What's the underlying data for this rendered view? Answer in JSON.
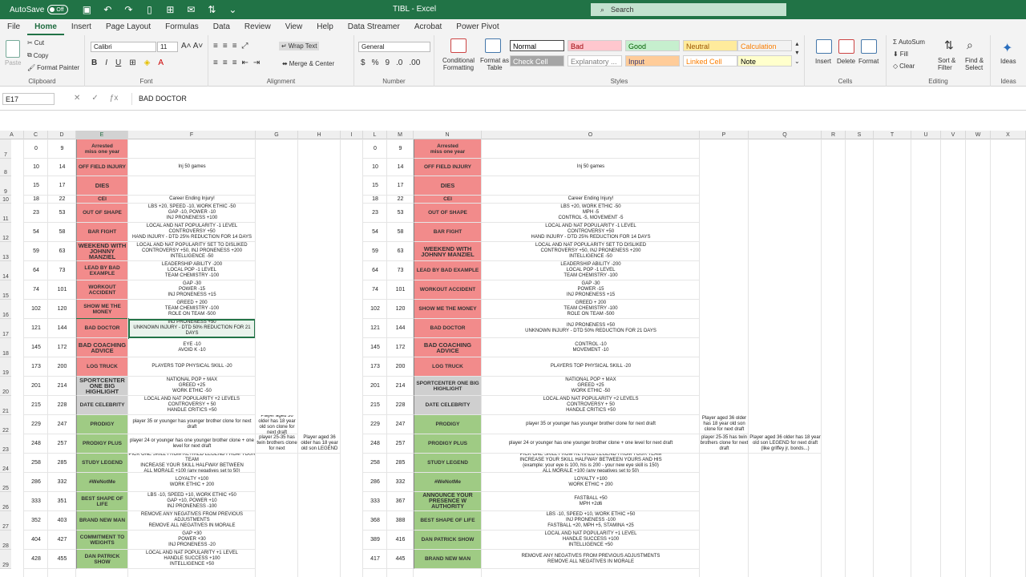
{
  "window": {
    "autosave": "AutoSave",
    "toggle": "Off",
    "title": "TIBL  -  Excel",
    "search_placeholder": "Search"
  },
  "menu": [
    "File",
    "Home",
    "Insert",
    "Page Layout",
    "Formulas",
    "Data",
    "Review",
    "View",
    "Help",
    "Data Streamer",
    "Acrobat",
    "Power Pivot"
  ],
  "ribbon": {
    "clipboard": {
      "paste": "Paste",
      "cut": "Cut",
      "copy": "Copy",
      "format_painter": "Format Painter",
      "label": "Clipboard"
    },
    "font": {
      "name": "Calibri",
      "size": "11",
      "label": "Font"
    },
    "alignment": {
      "wrap": "Wrap Text",
      "merge": "Merge & Center",
      "label": "Alignment"
    },
    "number": {
      "format": "General",
      "label": "Number"
    },
    "styles": {
      "conditional": "Conditional Formatting",
      "format_table": "Format as Table",
      "label": "Styles",
      "cells": [
        {
          "t": "Normal",
          "bg": "#ffffff",
          "fg": "#000000"
        },
        {
          "t": "Bad",
          "bg": "#ffc7ce",
          "fg": "#9c0006"
        },
        {
          "t": "Good",
          "bg": "#c6efce",
          "fg": "#006100"
        },
        {
          "t": "Neutral",
          "bg": "#ffeb9c",
          "fg": "#9c5700"
        },
        {
          "t": "Calculation",
          "bg": "#f2f2f2",
          "fg": "#fa7d00"
        },
        {
          "t": "Check Cell",
          "bg": "#a5a5a5",
          "fg": "#ffffff"
        },
        {
          "t": "Explanatory ...",
          "bg": "#ffffff",
          "fg": "#7f7f7f"
        },
        {
          "t": "Input",
          "bg": "#ffcc99",
          "fg": "#3f3f76"
        },
        {
          "t": "Linked Cell",
          "bg": "#ffffff",
          "fg": "#fa7d00"
        },
        {
          "t": "Note",
          "bg": "#ffffcc",
          "fg": "#000000"
        }
      ]
    },
    "cells": {
      "insert": "Insert",
      "delete": "Delete",
      "format": "Format",
      "label": "Cells"
    },
    "editing": {
      "autosum": "AutoSum",
      "fill": "Fill",
      "clear": "Clear",
      "sort": "Sort & Filter",
      "find": "Find & Select",
      "label": "Editing"
    },
    "ideas": {
      "label": "Ideas",
      "btn": "Ideas"
    }
  },
  "formula_bar": {
    "namebox": "E17",
    "content": "BAD DOCTOR"
  },
  "columns": [
    "A",
    "C",
    "D",
    "E",
    "F",
    "G",
    "H",
    "I",
    "L",
    "M",
    "N",
    "O",
    "P",
    "Q",
    "R",
    "S",
    "T",
    "U",
    "V",
    "W",
    "X"
  ],
  "rows": [
    {
      "n": "7",
      "c": "0",
      "d": "9",
      "e": "Arrested\nmiss one year",
      "f": "",
      "l": "0",
      "m": "9",
      "o": "",
      "color": "red"
    },
    {
      "n": "8",
      "c": "10",
      "d": "14",
      "e": "OFF FIELD INJURY",
      "f": "Inj 50 games",
      "l": "10",
      "m": "14",
      "o": "Inj 50 games",
      "color": "red"
    },
    {
      "n": "9",
      "c": "15",
      "d": "17",
      "e": "DIES",
      "f": "",
      "l": "15",
      "m": "17",
      "o": "",
      "color": "red"
    },
    {
      "n": "10",
      "c": "18",
      "d": "22",
      "e": "CEI",
      "f": "Career Ending Injury!",
      "l": "18",
      "m": "22",
      "o": "Career Ending Injury!",
      "color": "red"
    },
    {
      "n": "11",
      "c": "23",
      "d": "53",
      "e": "OUT OF SHAPE",
      "f": "LBS +20, SPEED -10, WORK ETHIC -50\nGAP -10, POWER -10\nINJ PRONENESS +100",
      "l": "23",
      "m": "53",
      "o": "LBS +20, WORK ETHIC -50\nMPH -5\nCONTROL -5, MOVEMENT -5",
      "color": "red"
    },
    {
      "n": "12",
      "c": "54",
      "d": "58",
      "e": "BAR FIGHT",
      "f": "LOCAL AND NAT POPULARITY -1 LEVEL\nCONTROVERSY +50\nHAND INJURY - DTD 25% REDUCTION FOR 14 DAYS",
      "l": "54",
      "m": "58",
      "o": "LOCAL AND NAT POPULARITY -1 LEVEL\nCONTROVERSY +50\nHAND INJURY - DTD 25% REDUCTION FOR 14 DAYS",
      "color": "red"
    },
    {
      "n": "13",
      "c": "59",
      "d": "63",
      "e": "WEEKEND WITH JOHNNY MANZIEL",
      "f": "LOCAL AND NAT POPULARITY SET TO DISLIKED\nCONTROVERSY +50, INJ PRONENESS +200\nINTELLIGENCE -50",
      "l": "59",
      "m": "63",
      "o": "LOCAL AND NAT POPULARITY SET TO DISLIKED\nCONTROVERSY +50, INJ PRONENESS +200\nINTELLIGENCE -50",
      "color": "red"
    },
    {
      "n": "14",
      "c": "64",
      "d": "73",
      "e": "LEAD BY BAD EXAMPLE",
      "f": "LEADERSHIP ABILITY -200\nLOCAL POP -1 LEVEL\nTEAM CHEMISTRY -100",
      "l": "64",
      "m": "73",
      "o": "LEADERSHIP ABILITY -200\nLOCAL POP -1 LEVEL\nTEAM CHEMISTRY -100",
      "color": "red"
    },
    {
      "n": "15",
      "c": "74",
      "d": "101",
      "e": "WORKOUT ACCIDENT",
      "f": "GAP -30\nPOWER -15\nINJ PRONENESS +15",
      "l": "74",
      "m": "101",
      "o": "GAP -30\nPOWER -15\nINJ PRONENESS +15",
      "color": "red"
    },
    {
      "n": "16",
      "c": "102",
      "d": "120",
      "e": "SHOW ME THE MONEY",
      "f": "GREED + 200\nTEAM CHEMISTRY -100\nROLE ON TEAM -500",
      "l": "102",
      "m": "120",
      "o": "GREED + 200\nTEAM CHEMISTRY -100\nROLE ON TEAM -500",
      "color": "red"
    },
    {
      "n": "17",
      "c": "121",
      "d": "144",
      "e": "BAD DOCTOR",
      "f": "INJ PRONENESS +50\nUNKNOWN INJURY - DTD 50% REDUCTION FOR 21 DAYS",
      "l": "121",
      "m": "144",
      "o": "INJ PRONENESS +50\nUNKNOWN INJURY - DTD 50% REDUCTION FOR 21 DAYS",
      "color": "red"
    },
    {
      "n": "18",
      "c": "145",
      "d": "172",
      "e": "BAD COACHING ADVICE",
      "f": "EYE -10\nAVOID K -10",
      "l": "145",
      "m": "172",
      "o": "CONTROL -10\nMOVEMENT -10",
      "color": "red"
    },
    {
      "n": "19",
      "c": "173",
      "d": "200",
      "e": "LOG TRUCK",
      "f": "PLAYERS TOP PHYSICAL SKILL -20",
      "l": "173",
      "m": "200",
      "o": "PLAYERS TOP PHYSICAL SKILL -20",
      "color": "red"
    },
    {
      "n": "20",
      "c": "201",
      "d": "214",
      "e": "SPORTCENTER ONE BIG HIGHLIGHT",
      "f": "NATIONAL POP + MAX\nGREED +25\nWORK ETHIC -50",
      "l": "201",
      "m": "214",
      "o": "NATIONAL POP + MAX\nGREED +25\nWORK ETHIC -50",
      "color": "gry"
    },
    {
      "n": "21",
      "c": "215",
      "d": "228",
      "e": "DATE CELEBRITY",
      "f": "LOCAL AND NAT POPULARITY +2 LEVELS\nCONTROVERSY + 50\nHANDLE CRITICS +50",
      "l": "215",
      "m": "228",
      "o": "LOCAL AND NAT POPULARITY +2 LEVELS\nCONTROVERSY + 50\nHANDLE CRITICS +50",
      "color": "gry"
    },
    {
      "n": "22",
      "c": "229",
      "d": "247",
      "e": "PRODIGY",
      "f": "player 35 or younger has younger brother clone for next draft",
      "g": "Player aged 36 older has 18 year old son clone for next draft",
      "l": "229",
      "m": "247",
      "o": "player 35 or younger has younger brother clone for next draft",
      "p": "Player aged 36 older has 18 year old son clone for next draft",
      "color": "grn"
    },
    {
      "n": "23",
      "c": "248",
      "d": "257",
      "e": "PRODIGY PLUS",
      "f": "player 24 or younger has one younger brother clone + one level for next draft",
      "g": "player 25-35 has twin brothers clone for next",
      "h": "Player aged 36 older has 18 year old son LEGEND",
      "l": "248",
      "m": "257",
      "o": "player 24 or younger has one younger brother clone + one level for next draft",
      "p": "player 25-35 has twin brothers clone for next draft",
      "q": "Player aged 36 older has 18 year old son LEGEND for next draft (like griffey jr, bonds...)",
      "color": "grn"
    },
    {
      "n": "24",
      "c": "258",
      "d": "285",
      "e": "STUDY LEGEND",
      "f": "PICK ONE SKILL FROM RETIRED LEGEND FROM YOUR TEAM\nINCREASE YOUR SKILL HALFWAY BETWEEN\nALL MORALE +100 (any negatives set to 50)",
      "l": "258",
      "m": "285",
      "o": "PICK ONE SKILL FROM RETIRED LEGEND FROM YOUR TEAM\nINCREASE YOUR SKILL HALFWAY BETWEEN YOURS AND HIS\n(example: your eye is 100, his is 200 - your new eye skill is 150)\nALL MORALE +100 (any negatives set to 50)",
      "color": "grn"
    },
    {
      "n": "25",
      "c": "286",
      "d": "332",
      "e": "#WeNotMe",
      "f": "LOYALTY +100\nWORK ETHIC + 200",
      "l": "286",
      "m": "332",
      "o": "LOYALTY +100\nWORK ETHIC + 200",
      "color": "grn"
    },
    {
      "n": "26",
      "c": "333",
      "d": "351",
      "e": "BEST SHAPE OF LIFE",
      "f": "LBS -10, SPEED +10, WORK ETHIC +50\nGAP +10, POWER +10\nINJ PRONENESS -100",
      "l": "333",
      "m": "367",
      "ne": "ANNOUNCE YOUR PRESENCE W AUTHORITY",
      "o": "FASTBALL +50\nMPH +2d6",
      "color": "grn"
    },
    {
      "n": "27",
      "c": "352",
      "d": "403",
      "e": "BRAND NEW MAN",
      "f": "REMOVE ANY NEGATIVES FROM PREVIOUS ADJUSTMENTS\nREMOVE ALL NEGATIVES IN MORALE",
      "l": "368",
      "m": "388",
      "ne": "BEST SHAPE OF LIFE",
      "o": "LBS -10, SPEED +10, WORK ETHIC +50\nINJ PRONENESS -100\nFASTBALL +20, MPH +5, STAMINA +25",
      "color": "grn"
    },
    {
      "n": "28",
      "c": "404",
      "d": "427",
      "e": "COMMITMENT TO WEIGHTS",
      "f": "GAP +30\nPOWER +30\nINJ PRONENESS -20",
      "l": "389",
      "m": "416",
      "ne": "DAN PATRICK SHOW",
      "o": "LOCAL AND NAT POPULARITY +1 LEVEL\nHANDLE SUCCESS +100\nINTELLIGENCE +50",
      "color": "grn"
    },
    {
      "n": "29",
      "c": "428",
      "d": "455",
      "e": "DAN PATRICK SHOW",
      "f": "LOCAL AND NAT POPULARITY +1 LEVEL\nHANDLE SUCCESS +100\nINTELLIGENCE +50",
      "l": "417",
      "m": "445",
      "ne": "BRAND NEW MAN",
      "o": "REMOVE ANY NEGATIVES FROM PREVIOUS ADJUSTMENTS\nREMOVE ALL NEGATIVES IN MORALE",
      "color": "grn"
    }
  ]
}
